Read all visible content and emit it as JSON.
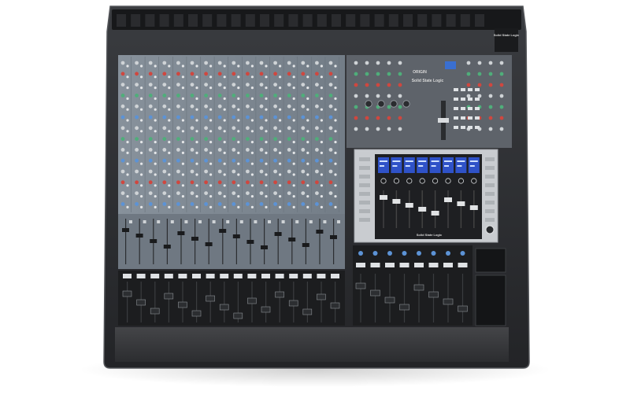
{
  "product": {
    "brand_badge": "Solid State Logic",
    "center_brand": "Solid State Logic",
    "center_model": "ORIGIN",
    "fader_module_brand": "Solid State Logic"
  },
  "colors": {
    "background": "#ffffff",
    "chassis": "#2b2d30",
    "chassis_edge": "#4a4c50",
    "channel_panel": "#7d8791",
    "center_panel": "#5c6168",
    "fader_bay": "#1c1d1f",
    "armrest": "#3a3b3e",
    "screen_blue": "#2f52c8",
    "module_silver": "#c9ccd0",
    "knob_red": "#d0473f",
    "knob_green": "#4fae7a",
    "knob_blue": "#5c93d6",
    "knob_grey": "#cfd3d6"
  },
  "icons": {
    "knob": "rotary-knob-icon",
    "fader": "fader-cap-icon",
    "display": "channel-display-icon"
  }
}
